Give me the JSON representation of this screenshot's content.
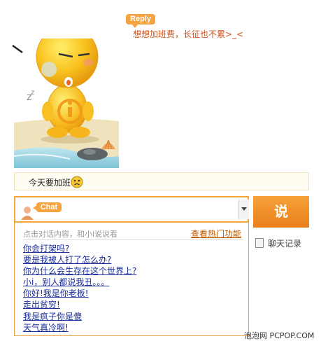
{
  "reply": {
    "badge": "Reply",
    "message": "想想加班费，长征也不累>_<"
  },
  "chat_log": {
    "message": "今天要加班"
  },
  "input": {
    "badge": "Chat",
    "value": ""
  },
  "say_button": "说",
  "history_label": "聊天记录",
  "suggestions": {
    "hint": "点击对话内容，和小i说说看",
    "hot_link": "查看热门功能",
    "items": [
      "你会打架吗?",
      "要是我被人打了怎么办?",
      "你为什么会生存在这个世界上?",
      "小i，别人都说我丑。。。",
      "你好!我是你老板!",
      "走出贫穷!",
      "我是疯子你是傻",
      "天气真冷啊!"
    ]
  },
  "watermark": "泡泡网 PCPOP.COM",
  "colors": {
    "accent": "#f5a441",
    "reply_text": "#d0531d",
    "link": "#1a2d9c"
  }
}
